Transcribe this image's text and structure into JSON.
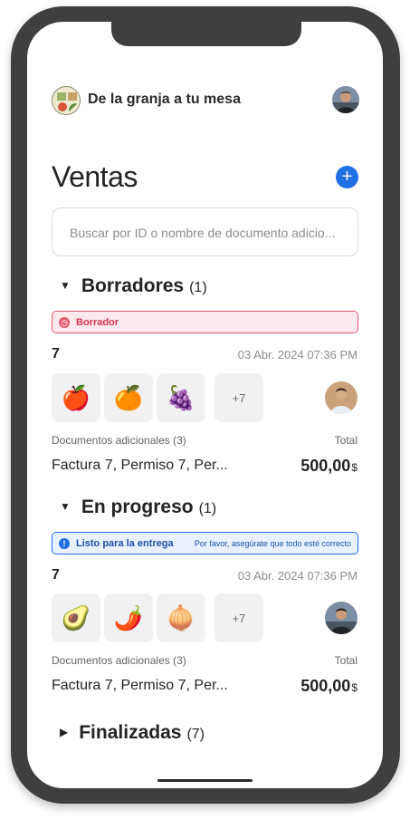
{
  "header": {
    "brand_title": "De la granja a tu mesa"
  },
  "page": {
    "title": "Ventas",
    "add_icon": "+"
  },
  "search": {
    "placeholder": "Buscar por ID o nombre de documento adicio..."
  },
  "sections": [
    {
      "title": "Borradores",
      "count": "(1)",
      "expanded": true,
      "status": {
        "label": "Borrador",
        "note": "",
        "color": "#e4576d"
      },
      "order": {
        "id": "7",
        "date": "03 Abr. 2024 07:36 PM",
        "products": [
          "🍎",
          "🍊",
          "🍇"
        ],
        "more": "+7",
        "docs_label": "Documentos adicionales",
        "docs_count": "(3)",
        "total_label": "Total",
        "docs": "Factura 7, Permiso 7, Per...",
        "amount": "500,00",
        "currency": "$"
      }
    },
    {
      "title": "En progreso",
      "count": "(1)",
      "expanded": true,
      "status": {
        "label": "Listo para la entrega",
        "note": "Por favor, asegúrate que todo esté correcto",
        "color": "#1f6fe5"
      },
      "order": {
        "id": "7",
        "date": "03 Abr. 2024 07:36 PM",
        "products": [
          "🥑",
          "🌶️",
          "🧅"
        ],
        "more": "+7",
        "docs_label": "Documentos adicionales",
        "docs_count": "(3)",
        "total_label": "Total",
        "docs": "Factura 7, Permiso 7, Per...",
        "amount": "500,00",
        "currency": "$"
      }
    },
    {
      "title": "Finalizadas",
      "count": "(7)",
      "expanded": false
    }
  ]
}
